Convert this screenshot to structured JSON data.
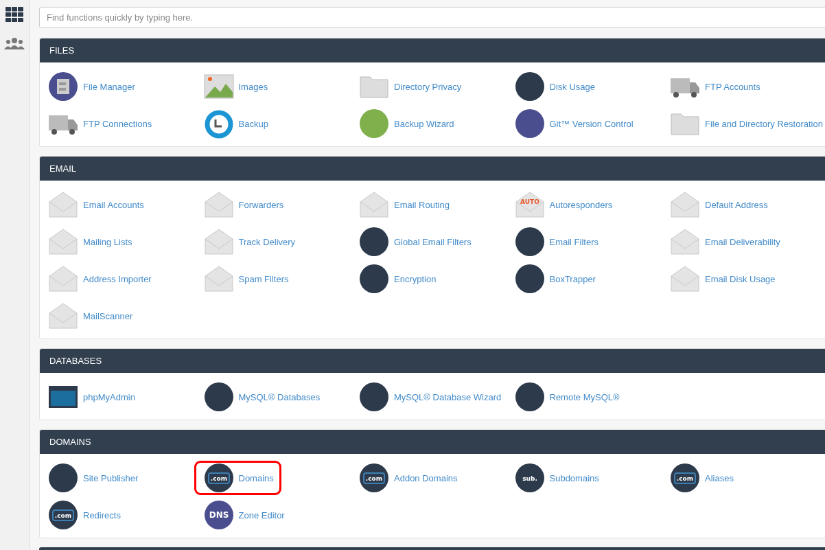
{
  "search": {
    "placeholder": "Find functions quickly by typing here."
  },
  "sections": [
    {
      "title": "FILES",
      "items": [
        {
          "label": "File Manager",
          "kind": "cabinet"
        },
        {
          "label": "Images",
          "kind": "picture"
        },
        {
          "label": "Directory Privacy",
          "kind": "folder"
        },
        {
          "label": "Disk Usage",
          "kind": "disc"
        },
        {
          "label": "FTP Accounts",
          "kind": "truck"
        },
        {
          "label": "FTP Connections",
          "kind": "truck"
        },
        {
          "label": "Backup",
          "kind": "ring"
        },
        {
          "label": "Backup Wizard",
          "kind": "disc-green"
        },
        {
          "label": "Git™ Version Control",
          "kind": "disc-accent"
        },
        {
          "label": "File and Directory Restoration",
          "kind": "folder"
        }
      ]
    },
    {
      "title": "EMAIL",
      "items": [
        {
          "label": "Email Accounts",
          "kind": "envelope"
        },
        {
          "label": "Forwarders",
          "kind": "envelope"
        },
        {
          "label": "Email Routing",
          "kind": "envelope"
        },
        {
          "label": "Autoresponders",
          "kind": "envelope",
          "badge": "AUTO"
        },
        {
          "label": "Default Address",
          "kind": "envelope"
        },
        {
          "label": "Mailing Lists",
          "kind": "envelope"
        },
        {
          "label": "Track Delivery",
          "kind": "envelope"
        },
        {
          "label": "Global Email Filters",
          "kind": "disc"
        },
        {
          "label": "Email Filters",
          "kind": "disc"
        },
        {
          "label": "Email Deliverability",
          "kind": "envelope"
        },
        {
          "label": "Address Importer",
          "kind": "envelope"
        },
        {
          "label": "Spam Filters",
          "kind": "envelope"
        },
        {
          "label": "Encryption",
          "kind": "disc"
        },
        {
          "label": "BoxTrapper",
          "kind": "disc"
        },
        {
          "label": "Email Disk Usage",
          "kind": "envelope"
        },
        {
          "label": "MailScanner",
          "kind": "envelope"
        }
      ]
    },
    {
      "title": "DATABASES",
      "items": [
        {
          "label": "phpMyAdmin",
          "kind": "window"
        },
        {
          "label": "MySQL® Databases",
          "kind": "disc"
        },
        {
          "label": "MySQL® Database Wizard",
          "kind": "disc"
        },
        {
          "label": "Remote MySQL®",
          "kind": "disc"
        }
      ]
    },
    {
      "title": "DOMAINS",
      "items": [
        {
          "label": "Site Publisher",
          "kind": "disc"
        },
        {
          "label": "Domains",
          "kind": "disc",
          "badge": ".com",
          "highlighted": true
        },
        {
          "label": "Addon Domains",
          "kind": "disc",
          "badge": ".com"
        },
        {
          "label": "Subdomains",
          "kind": "disc",
          "badge": "sub."
        },
        {
          "label": "Aliases",
          "kind": "disc",
          "badge": ".com"
        },
        {
          "label": "Redirects",
          "kind": "disc",
          "badge": ".com"
        },
        {
          "label": "Zone Editor",
          "kind": "disc-accent",
          "badge": "DNS"
        }
      ]
    }
  ]
}
